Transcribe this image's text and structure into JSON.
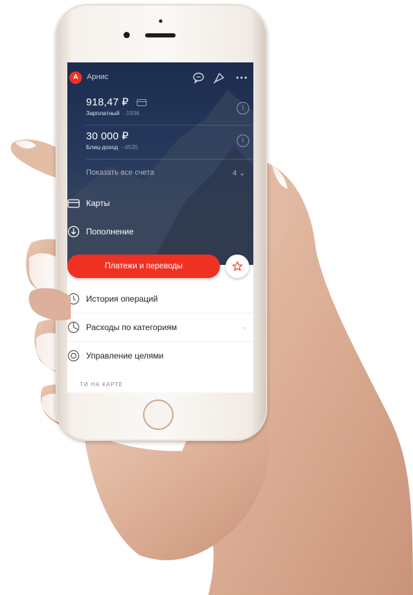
{
  "header": {
    "user_name": "Арнис",
    "logo_letter": "А"
  },
  "accounts": [
    {
      "amount": "918,47 ₽",
      "name": "Зарплатный",
      "number": "··1936"
    },
    {
      "amount": "30 000 ₽",
      "name": "Блиц-доход",
      "number": "··4535"
    }
  ],
  "show_all": {
    "label": "Показать все счета",
    "count": "4"
  },
  "menu": [
    {
      "label": "Карты",
      "icon": "card-icon"
    },
    {
      "label": "Пополнение",
      "icon": "download-icon"
    }
  ],
  "actions": {
    "payments_label": "Платежи и переводы",
    "favorite_icon": "star-icon"
  },
  "list": [
    {
      "label": "История операций",
      "icon": "clock-icon"
    },
    {
      "label": "Расходы по категориям",
      "icon": "pie-chart-icon"
    },
    {
      "label": "Управление целями",
      "icon": "target-icon"
    }
  ],
  "section": {
    "label": "ТИ НА КАРТЕ"
  },
  "colors": {
    "brand": "#ef3124",
    "hero": "#1c2c4e"
  }
}
